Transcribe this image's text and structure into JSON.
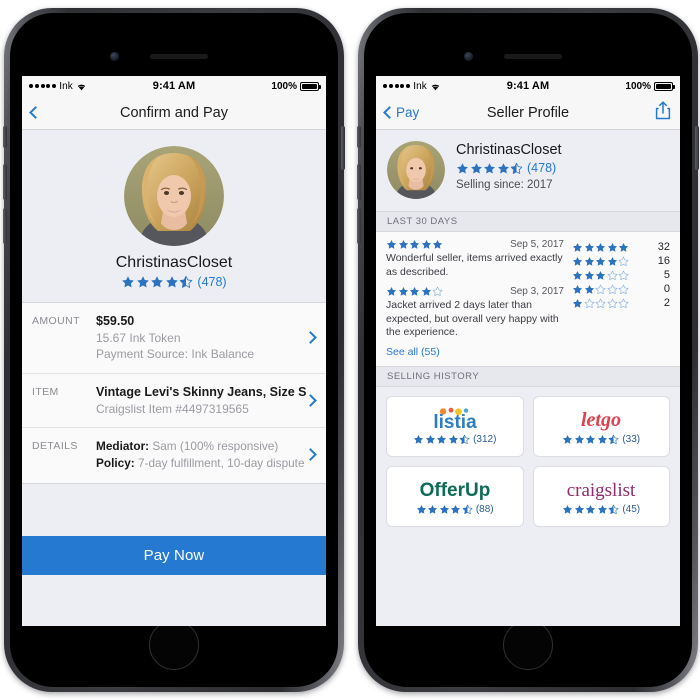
{
  "colors": {
    "accent": "#2579d1",
    "star": "#2b72bf",
    "screen_bg": "#eceef3",
    "card_bg": "#fafafb"
  },
  "phones": [
    {
      "id": "confirm-and-pay",
      "status_bar": {
        "carrier": "Ink",
        "time": "9:41 AM",
        "battery": "100%"
      },
      "nav": {
        "title": "Confirm and Pay",
        "back_label": "",
        "share": false
      },
      "hero": {
        "name": "ChristinasCloset",
        "rating": 4.5,
        "rating_count": "(478)"
      },
      "rows": [
        {
          "label": "AMOUNT",
          "primary": "$59.50",
          "sub1": "15.67 Ink Token",
          "sub2": "Payment Source: Ink Balance"
        },
        {
          "label": "ITEM",
          "primary": "Vintage Levi's Skinny Jeans, Size S",
          "sub1": "Craigslist Item #4497319565",
          "sub2": ""
        },
        {
          "label": "DETAILS",
          "kv": [
            {
              "key": "Mediator:",
              "val": "Sam (100% responsive)"
            },
            {
              "key": "Policy:",
              "val": "7-day fulfillment, 10-day dispute"
            }
          ]
        }
      ],
      "pay_button": "Pay Now"
    },
    {
      "id": "seller-profile",
      "status_bar": {
        "carrier": "Ink",
        "time": "9:41 AM",
        "battery": "100%"
      },
      "nav": {
        "title": "Seller Profile",
        "back_label": "Pay",
        "share": true
      },
      "seller": {
        "name": "ChristinasCloset",
        "rating": 4.5,
        "rating_count": "(478)",
        "since": "Selling since: 2017"
      },
      "reviews_section": {
        "header": "LAST 30 DAYS",
        "items": [
          {
            "rating": 5,
            "date": "Sep 5, 2017",
            "text": "Wonderful seller, items arrived exactly as described."
          },
          {
            "rating": 4,
            "date": "Sep 3, 2017",
            "text": "Jacket arrived 2 days later than expected, but overall very happy with the experience."
          }
        ],
        "see_all": "See all (55)",
        "distribution": [
          {
            "stars": 5,
            "count": "32"
          },
          {
            "stars": 4,
            "count": "16"
          },
          {
            "stars": 3,
            "count": "5"
          },
          {
            "stars": 2,
            "count": "0"
          },
          {
            "stars": 1,
            "count": "2"
          }
        ]
      },
      "history_section": {
        "header": "SELLING HISTORY",
        "cards": [
          {
            "logo": "listia",
            "rating": 4.5,
            "count": "(312)"
          },
          {
            "logo": "letgo",
            "rating": 4.5,
            "count": "(33)"
          },
          {
            "logo": "OfferUp",
            "rating": 4.5,
            "count": "(88)"
          },
          {
            "logo": "craigslist",
            "rating": 4.5,
            "count": "(45)"
          }
        ]
      }
    }
  ]
}
